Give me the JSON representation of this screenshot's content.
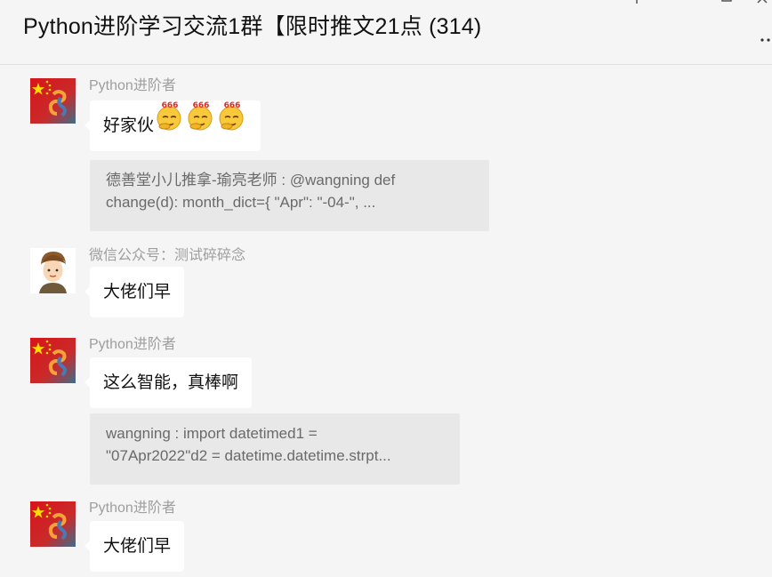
{
  "window": {
    "title": "Python进阶学习交流1群【限时推文21点 (314)",
    "pin_icon": "pin-icon",
    "minimize_icon": "minimize-icon",
    "maximize_icon": "maximize-icon",
    "close_icon": "close-icon",
    "more_icon": "more-options-icon"
  },
  "messages": [
    {
      "sender": "Python进阶者",
      "text": "好家伙",
      "emoji_label": "666",
      "emoji_count": 3,
      "quote": [
        "德善堂小儿推拿-瑜亮老师 : @wangning def",
        "change(d):    month_dict={         \"Apr\": \"-04-\",  ..."
      ]
    },
    {
      "sender": "微信公众号：测试碎碎念",
      "text": "大佬们早"
    },
    {
      "sender": "Python进阶者",
      "text": "这么智能，真棒啊",
      "quote": [
        "wangning : import datetimed1 =",
        "\"07Apr2022\"d2 = datetime.datetime.strpt..."
      ]
    },
    {
      "sender": "Python进阶者",
      "text": "大佬们早"
    }
  ],
  "colors": {
    "background": "#f5f5f5",
    "bubble": "#ffffff",
    "quote_bg": "#e8e8e8",
    "sender_text": "#9e9e9e"
  }
}
